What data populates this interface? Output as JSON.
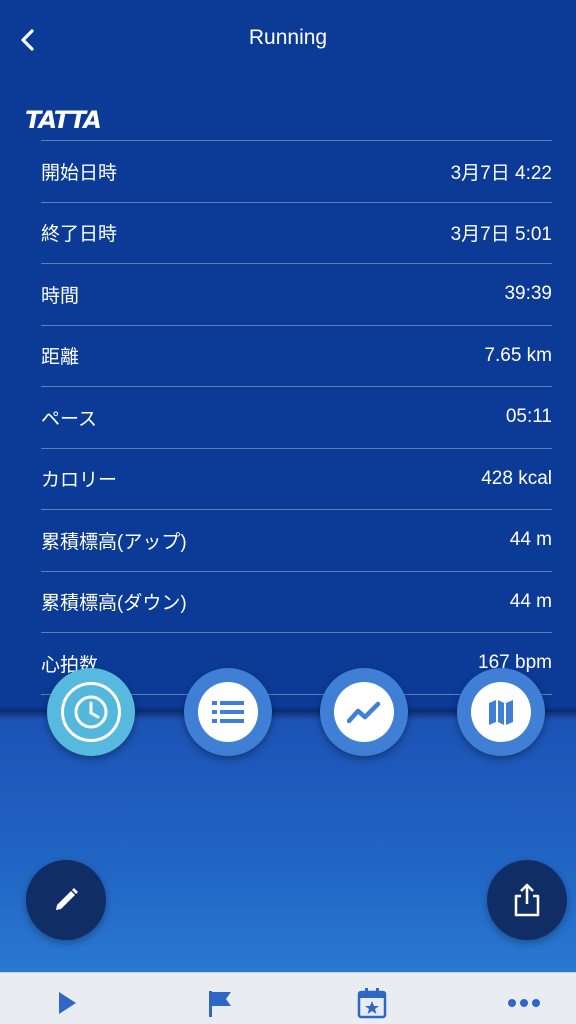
{
  "nav": {
    "title": "Running",
    "back_icon": "chevron-left-icon"
  },
  "logo": {
    "text": "TATTA"
  },
  "stats": [
    {
      "label": "開始日時",
      "value": "3月7日 4:22"
    },
    {
      "label": "終了日時",
      "value": "3月7日 5:01"
    },
    {
      "label": "時間",
      "value": "39:39"
    },
    {
      "label": "距離",
      "value": "7.65 km"
    },
    {
      "label": "ペース",
      "value": "05:11"
    },
    {
      "label": "カロリー",
      "value": "428 kcal"
    },
    {
      "label": "累積標高(アップ)",
      "value": "44 m"
    },
    {
      "label": "累積標高(ダウン)",
      "value": "44 m"
    },
    {
      "label": "心拍数",
      "value": "167 bpm"
    }
  ],
  "view_buttons": [
    {
      "icon": "clock-icon",
      "active": true
    },
    {
      "icon": "list-icon",
      "active": false
    },
    {
      "icon": "chart-line-icon",
      "active": false
    },
    {
      "icon": "map-icon",
      "active": false
    }
  ],
  "actions": {
    "edit_icon": "pencil-icon",
    "share_icon": "share-icon"
  },
  "tab_bar": [
    {
      "icon": "play-icon"
    },
    {
      "icon": "flag-icon"
    },
    {
      "icon": "calendar-star-icon"
    },
    {
      "icon": "more-icon"
    }
  ],
  "colors": {
    "top_background": "#0b3b96",
    "accent": "#3f7fd6",
    "active": "#54b8dc",
    "dark_button": "#112d66",
    "tab_icon": "#2f67c7"
  }
}
